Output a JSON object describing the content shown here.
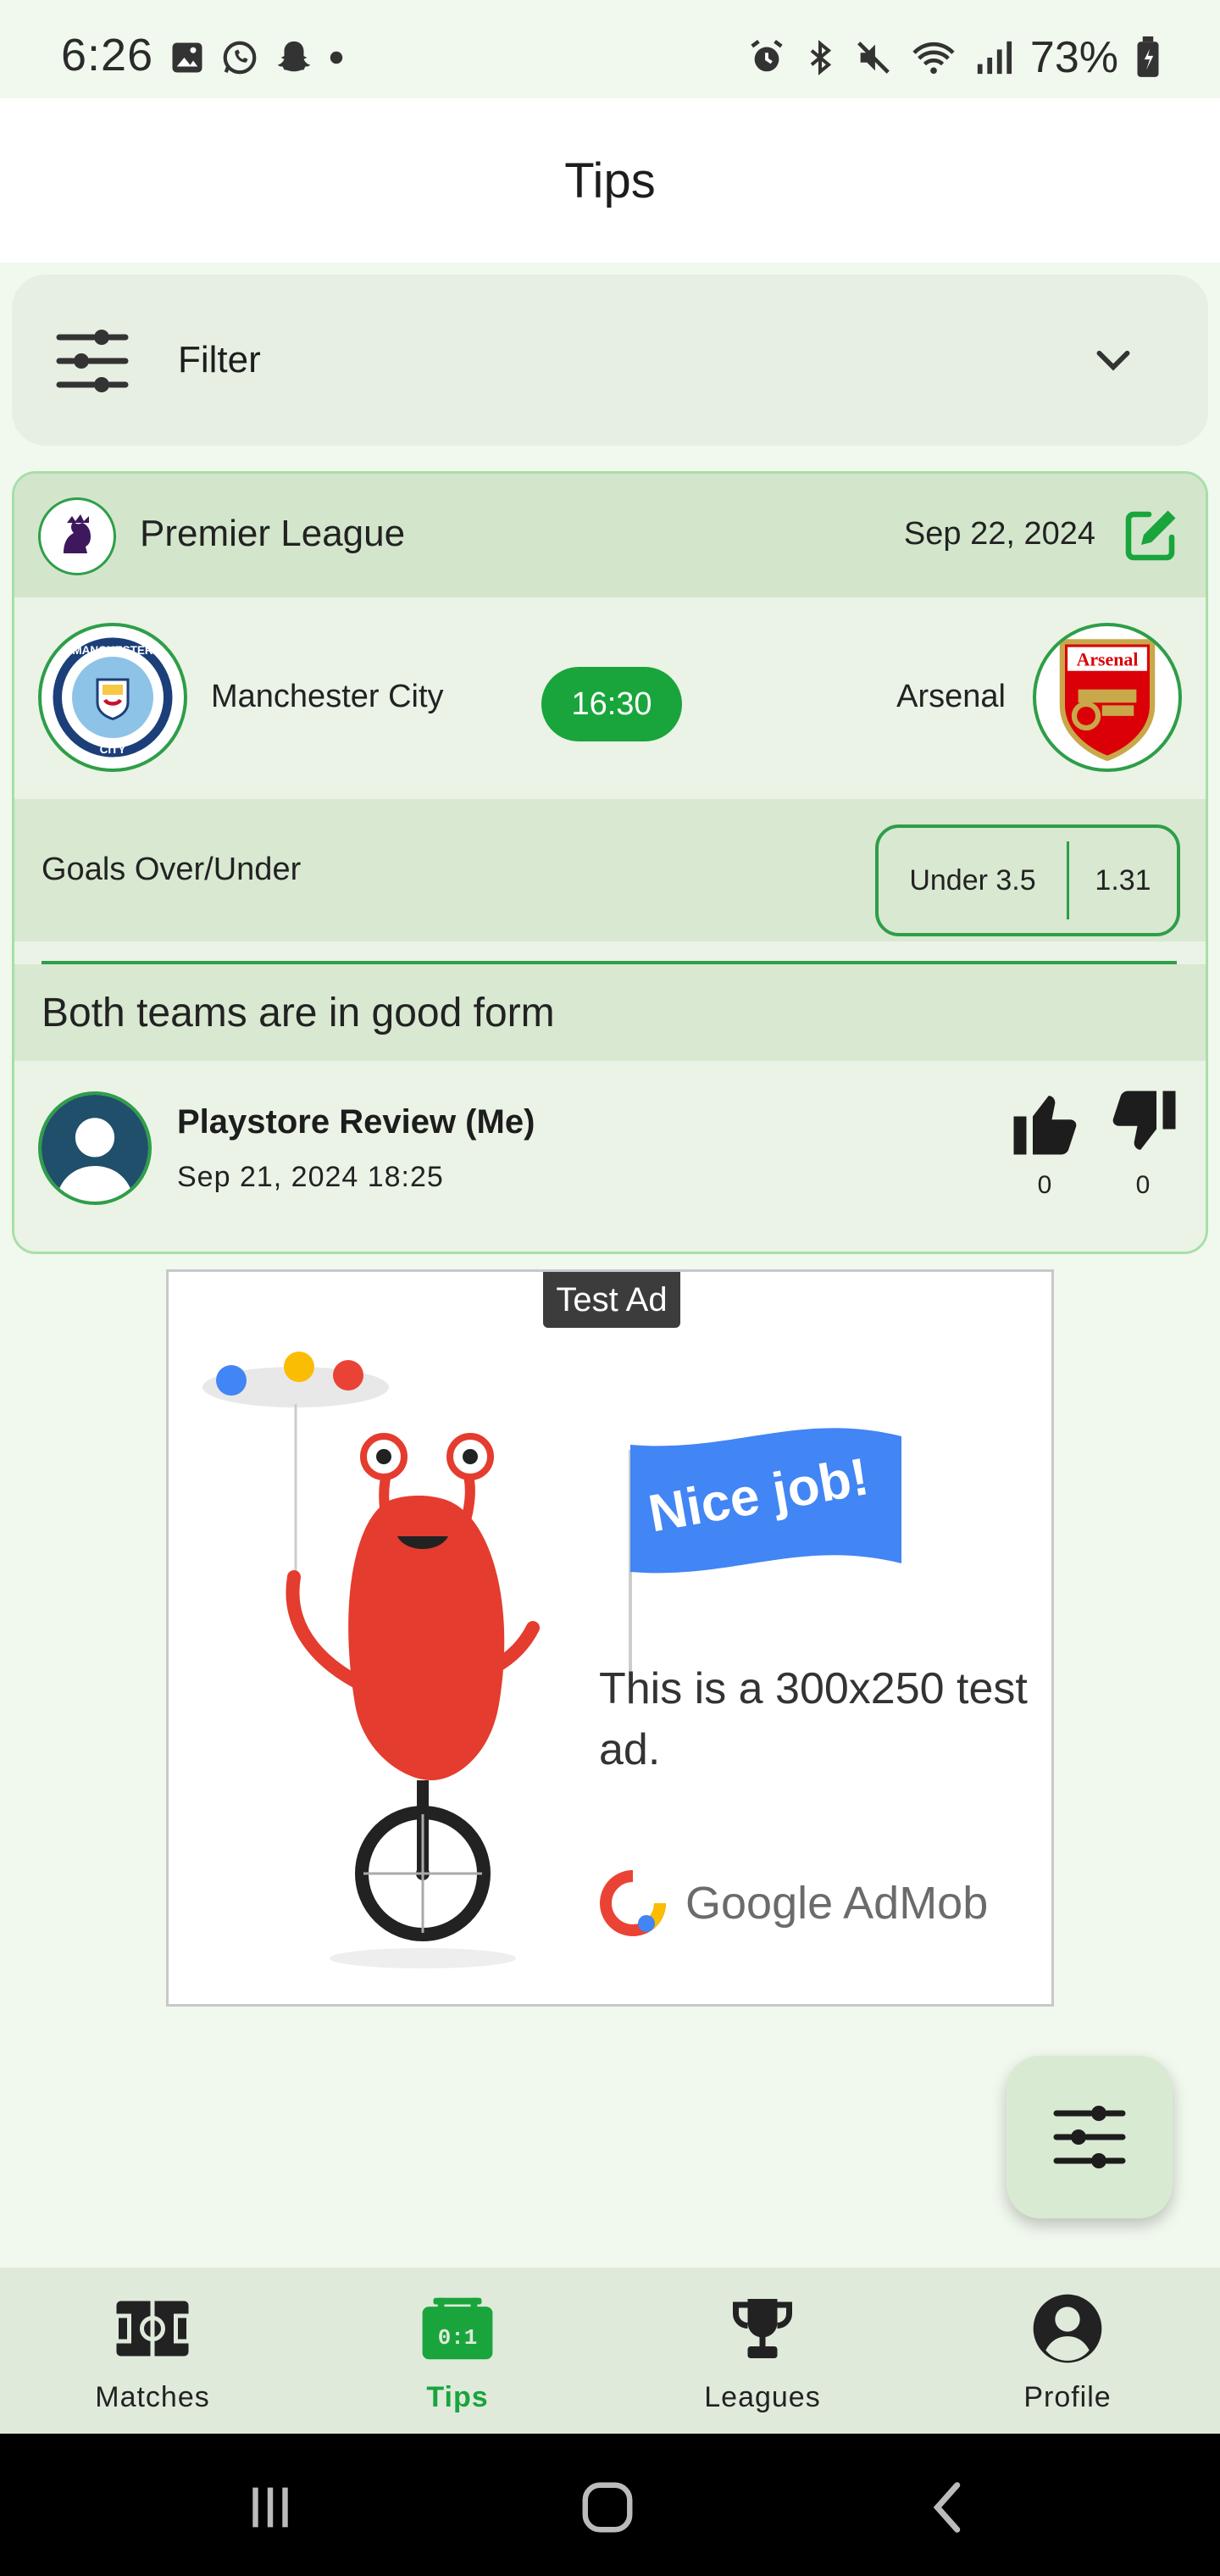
{
  "status_bar": {
    "time": "6:26",
    "battery": "73%",
    "left_icons": [
      "gallery-icon",
      "whatsapp-icon",
      "snapchat-icon",
      "dot-icon"
    ],
    "right_icons": [
      "alarm-icon",
      "bluetooth-icon",
      "mute-icon",
      "wifi-icon",
      "signal-icon",
      "battery-icon"
    ]
  },
  "header": {
    "title": "Tips"
  },
  "filter": {
    "label": "Filter"
  },
  "tip": {
    "league": "Premier League",
    "date": "Sep 22, 2024",
    "home_team": "Manchester City",
    "away_team": "Arsenal",
    "kickoff": "16:30",
    "home_logo_text": [
      "MANCHESTER",
      "CITY"
    ],
    "away_logo_text": "Arsenal",
    "market": "Goals Over/Under",
    "pick": "Under 3.5",
    "odds": "1.31",
    "comment": "Both teams are in good form",
    "author": "Playstore Review (Me)",
    "posted": "Sep 21, 2024 18:25",
    "likes": "0",
    "dislikes": "0"
  },
  "ad": {
    "badge": "Test Ad",
    "banner": "Nice job!",
    "text": "This is a 300x250 test ad.",
    "brand": "Google AdMob"
  },
  "bottom_nav": [
    {
      "label": "Matches",
      "icon": "pitch-icon",
      "active": false
    },
    {
      "label": "Tips",
      "icon": "scoreboard-icon",
      "active": true
    },
    {
      "label": "Leagues",
      "icon": "trophy-icon",
      "active": false
    },
    {
      "label": "Profile",
      "icon": "account-icon",
      "active": false
    }
  ],
  "colors": {
    "accent": "#19a53c",
    "background": "#f1f8ee",
    "card": "#eaf3e6",
    "card_header": "#d3e6cc"
  }
}
